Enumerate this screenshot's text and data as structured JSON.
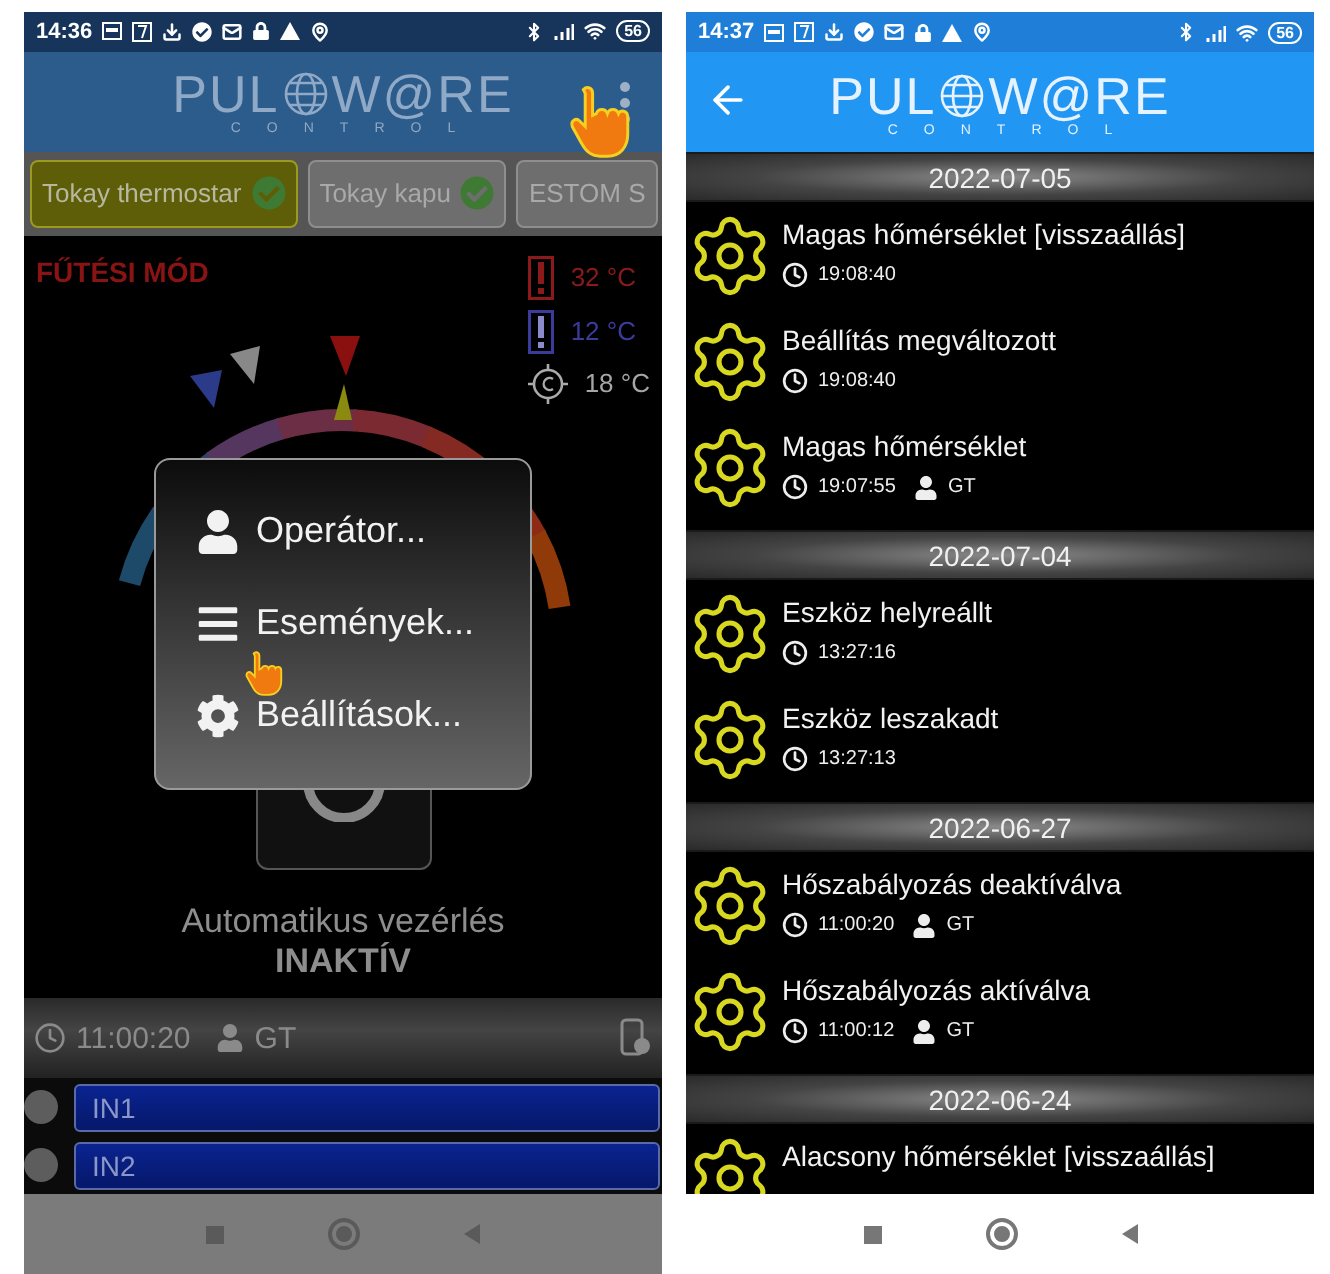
{
  "left_screen": {
    "status_bar": {
      "time": "14:36",
      "battery": "56"
    },
    "logo": {
      "left": "PUL",
      "right": "W@RE",
      "subtitle": "CONTROL"
    },
    "device_tabs": [
      {
        "label": "Tokay thermostar",
        "selected": true,
        "connected": true
      },
      {
        "label": "Tokay kapu",
        "selected": false,
        "connected": true
      },
      {
        "label": "ESTOM S",
        "selected": false,
        "connected": false
      }
    ],
    "mode_label": "FŰTÉSI MÓD",
    "temperatures": [
      {
        "kind": "high",
        "value": "32 °C"
      },
      {
        "kind": "low",
        "value": "12 °C"
      },
      {
        "kind": "target",
        "value": "18 °C"
      }
    ],
    "menu": [
      {
        "kind": "operator",
        "label": "Operátor..."
      },
      {
        "kind": "events",
        "label": "Események..."
      },
      {
        "kind": "settings",
        "label": "Beállítások..."
      }
    ],
    "automation": {
      "label": "Automatikus vezérlés",
      "status": "INAKTÍV"
    },
    "info_bar": {
      "time": "11:00:20",
      "user": "GT"
    },
    "inputs": [
      {
        "label": "IN1"
      },
      {
        "label": "IN2"
      }
    ]
  },
  "right_screen": {
    "status_bar": {
      "time": "14:37",
      "battery": "56"
    },
    "logo": {
      "left": "PUL",
      "right": "W@RE",
      "subtitle": "CONTROL"
    },
    "event_groups": [
      {
        "date": "2022-07-05",
        "events": [
          {
            "title": "Magas hőmérséklet [visszaállás]",
            "time": "19:08:40"
          },
          {
            "title": "Beállítás megváltozott",
            "time": "19:08:40"
          },
          {
            "title": "Magas hőmérséklet",
            "time": "19:07:55",
            "user": "GT"
          }
        ]
      },
      {
        "date": "2022-07-04",
        "events": [
          {
            "title": "Eszköz helyreállt",
            "time": "13:27:16"
          },
          {
            "title": "Eszköz leszakadt",
            "time": "13:27:13"
          }
        ]
      },
      {
        "date": "2022-06-27",
        "events": [
          {
            "title": "Hőszabályozás deaktíválva",
            "time": "11:00:20",
            "user": "GT"
          },
          {
            "title": "Hőszabályozás aktíválva",
            "time": "11:00:12",
            "user": "GT"
          }
        ]
      },
      {
        "date": "2022-06-24",
        "events": [
          {
            "title": "Alacsony hőmérséklet [visszaállás]"
          }
        ]
      }
    ]
  }
}
